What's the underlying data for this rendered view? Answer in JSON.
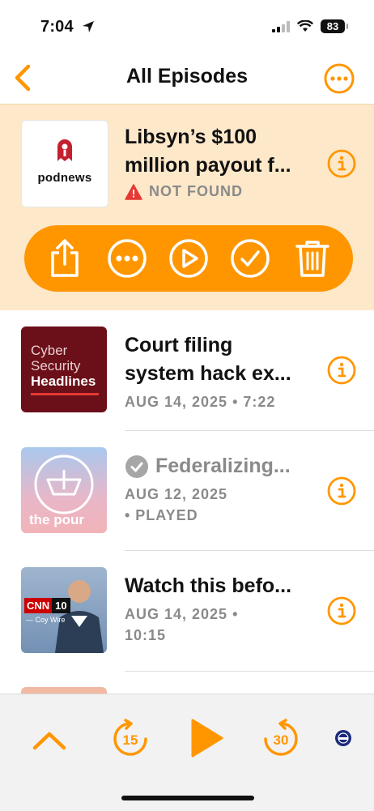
{
  "status_bar": {
    "time": "7:04",
    "battery": "83"
  },
  "nav": {
    "title": "All Episodes"
  },
  "episodes": [
    {
      "title": "Libsyn’s $100 million payout f...",
      "title_line1": "Libsyn’s $100",
      "title_line2": "million payout f...",
      "status": "NOT FOUND",
      "art_label": "podnews"
    },
    {
      "title_line1": "Court filing",
      "title_line2": "system hack ex...",
      "meta": "AUG 14, 2025 • 7:22",
      "art_line1": "Cyber",
      "art_line2": "Security",
      "art_line3": "Headlines"
    },
    {
      "title": "Federalizing...",
      "meta_line1": "AUG 12, 2025",
      "meta_line2": "• PLAYED",
      "art_label": "the pour over"
    },
    {
      "title": "Watch this befo...",
      "meta_line1": "AUG 14, 2025 •",
      "meta_line2": "10:15",
      "art_brand": "CNN",
      "art_num": "10",
      "art_sub": "— Coy Wire"
    }
  ],
  "player": {
    "skip_back": "15",
    "skip_forward": "30"
  },
  "colors": {
    "accent": "#ff9600",
    "selected_bg": "#fde8c9",
    "meta_gray": "#8a8a8a"
  }
}
